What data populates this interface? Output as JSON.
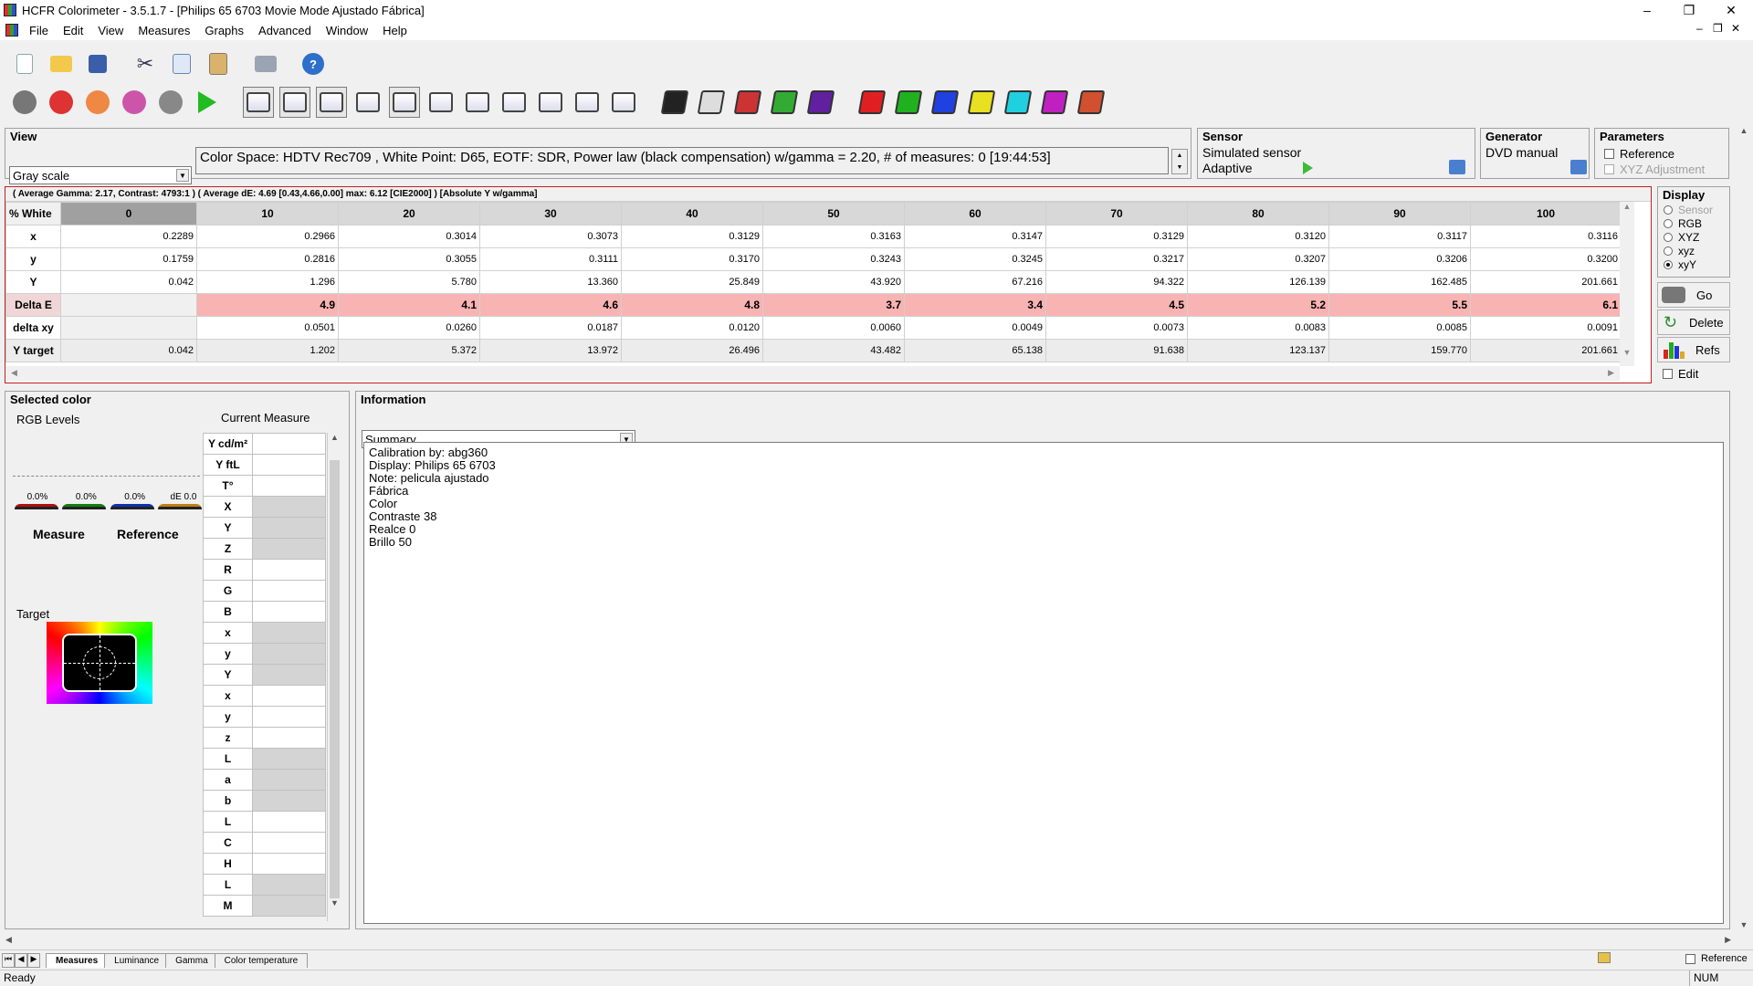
{
  "window": {
    "title": "HCFR Colorimeter - 3.5.1.7 - [Philips 65 6703 Movie Mode Ajustado Fábrica]",
    "controls": {
      "minimize": "–",
      "maximize": "❐",
      "close": "✕"
    },
    "mdi_controls": {
      "minimize": "–",
      "restore": "❐",
      "close": "✕"
    }
  },
  "menu": [
    "File",
    "Edit",
    "View",
    "Measures",
    "Graphs",
    "Advanced",
    "Window",
    "Help"
  ],
  "toolbar1": [
    "new-icon",
    "open-icon",
    "save-icon",
    "cut-icon",
    "copy-icon",
    "paste-icon",
    "print-icon",
    "help-icon"
  ],
  "toolbar2": [
    "sensor-icon",
    "rgb-balls-icon",
    "color-balls-icon",
    "color-cube-icon",
    "camera-icon",
    "play-icon",
    "monitor-1-icon",
    "monitor-2-icon",
    "monitor-3-icon",
    "monitor-4-icon",
    "monitor-5-icon",
    "monitor-6-icon",
    "monitor-7-icon",
    "monitor-8-icon",
    "monitor-9-icon",
    "monitor-10-icon",
    "monitor-11-icon",
    "film-black-icon",
    "film-white-icon",
    "film-rgb-1-icon",
    "film-rgb-2-icon",
    "film-flash-icon",
    "film-red-icon",
    "film-green-icon",
    "film-blue-icon",
    "film-yellow-icon",
    "film-cyan-icon",
    "film-magenta-icon",
    "film-mix-icon"
  ],
  "view": {
    "title": "View",
    "mode": "Gray scale",
    "status": "Color Space: HDTV Rec709 , White Point: D65, EOTF:  SDR, Power law (black compensation) w/gamma = 2.20, # of measures: 0 [19:44:53]"
  },
  "sensor": {
    "title": "Sensor",
    "name": "Simulated sensor",
    "mode": "Adaptive"
  },
  "generator": {
    "title": "Generator",
    "name": "DVD manual"
  },
  "parameters": {
    "title": "Parameters",
    "reference": "Reference",
    "xyz_adjust": "XYZ Adjustment"
  },
  "summary_line": "( Average Gamma: 2.17, Contrast: 4793:1 ) ( Average dE: 4.69 [0.43,4.66,0.00] max: 6.12 [CIE2000] ) [Absolute Y w/gamma]",
  "grid": {
    "header_label": "% White",
    "columns": [
      "0",
      "10",
      "20",
      "30",
      "40",
      "50",
      "60",
      "70",
      "80",
      "90",
      "100"
    ],
    "rows": [
      {
        "label": "x",
        "kind": "num",
        "values": [
          "0.2289",
          "0.2966",
          "0.3014",
          "0.3073",
          "0.3129",
          "0.3163",
          "0.3147",
          "0.3129",
          "0.3120",
          "0.3117",
          "0.3116"
        ]
      },
      {
        "label": "y",
        "kind": "num",
        "values": [
          "0.1759",
          "0.2816",
          "0.3055",
          "0.3111",
          "0.3170",
          "0.3243",
          "0.3245",
          "0.3217",
          "0.3207",
          "0.3206",
          "0.3200"
        ]
      },
      {
        "label": "Y",
        "kind": "num",
        "values": [
          "0.042",
          "1.296",
          "5.780",
          "13.360",
          "25.849",
          "43.920",
          "67.216",
          "94.322",
          "126.139",
          "162.485",
          "201.661"
        ]
      },
      {
        "label": "Delta E",
        "kind": "de",
        "values": [
          "",
          "4.9",
          "4.1",
          "4.6",
          "4.8",
          "3.7",
          "3.4",
          "4.5",
          "5.2",
          "5.5",
          "6.1"
        ]
      },
      {
        "label": "delta xy",
        "kind": "num",
        "values": [
          "",
          "0.0501",
          "0.0260",
          "0.0187",
          "0.0120",
          "0.0060",
          "0.0049",
          "0.0073",
          "0.0083",
          "0.0085",
          "0.0091"
        ]
      },
      {
        "label": "Y target",
        "kind": "yt",
        "values": [
          "0.042",
          "1.202",
          "5.372",
          "13.972",
          "26.496",
          "43.482",
          "65.138",
          "91.638",
          "123.137",
          "159.770",
          "201.661"
        ]
      }
    ]
  },
  "display": {
    "title": "Display",
    "options": [
      {
        "label": "Sensor",
        "disabled": true,
        "checked": false
      },
      {
        "label": "RGB",
        "disabled": false,
        "checked": false
      },
      {
        "label": "XYZ",
        "disabled": false,
        "checked": false
      },
      {
        "label": "xyz",
        "disabled": false,
        "checked": false
      },
      {
        "label": "xyY",
        "disabled": false,
        "checked": true
      }
    ],
    "go": "Go",
    "delete": "Delete",
    "refs": "Refs",
    "edit": "Edit"
  },
  "selected_color": {
    "title": "Selected color",
    "rgb_levels": "RGB Levels",
    "current_measure": "Current Measure",
    "percentages": [
      "0.0%",
      "0.0%",
      "0.0%",
      "dE 0.0"
    ],
    "measure": "Measure",
    "reference": "Reference",
    "target": "Target",
    "measure_rows": [
      {
        "label": "Y cd/m²",
        "g": false
      },
      {
        "label": "Y ftL",
        "g": false
      },
      {
        "label": "T°",
        "g": false
      },
      {
        "label": "X",
        "g": true
      },
      {
        "label": "Y",
        "g": true
      },
      {
        "label": "Z",
        "g": true
      },
      {
        "label": "R",
        "g": false
      },
      {
        "label": "G",
        "g": false
      },
      {
        "label": "B",
        "g": false
      },
      {
        "label": "x",
        "g": true
      },
      {
        "label": "y",
        "g": true
      },
      {
        "label": "Y",
        "g": true
      },
      {
        "label": "x",
        "g": false
      },
      {
        "label": "y",
        "g": false
      },
      {
        "label": "z",
        "g": false
      },
      {
        "label": "L",
        "g": true
      },
      {
        "label": "a",
        "g": true
      },
      {
        "label": "b",
        "g": true
      },
      {
        "label": "L",
        "g": false
      },
      {
        "label": "C",
        "g": false
      },
      {
        "label": "H",
        "g": false
      },
      {
        "label": "L",
        "g": true
      },
      {
        "label": "M",
        "g": true
      }
    ]
  },
  "information": {
    "title": "Information",
    "selector": "Summary",
    "lines": [
      "Calibration by: abg360",
      "Display: Philips 65 6703",
      "Note: pelicula ajustado",
      "Fábrica",
      "Color",
      "Contraste 38",
      "Realce 0",
      "Brillo 50"
    ]
  },
  "tabs": [
    "Measures",
    "Luminance",
    "Gamma",
    "Color temperature"
  ],
  "tab_nav": [
    "⏮",
    "◀",
    "▶"
  ],
  "bottom_reference": "Reference",
  "status": {
    "text": "Ready",
    "num": "NUM"
  },
  "colors": {
    "delta_e_bg": "#f8b3b3",
    "panel_bg": "#f0f0f0",
    "border": "#a0a0a0"
  }
}
